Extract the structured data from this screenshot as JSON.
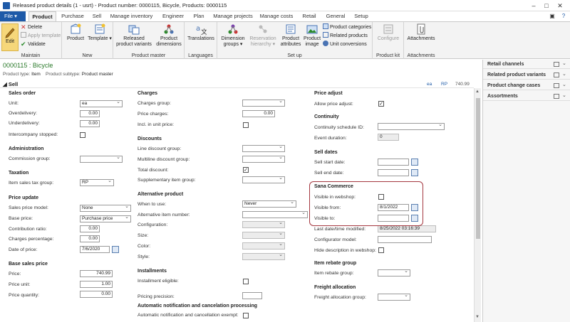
{
  "window": {
    "title": "Released product details (1 - usrt) - Product number: 0000115, Bicycle, Products: 0000115"
  },
  "ribbon_tabs": [
    "File",
    "Product",
    "Purchase",
    "Sell",
    "Manage inventory",
    "Engineer",
    "Plan",
    "Manage projects",
    "Manage costs",
    "Retail",
    "General",
    "Setup"
  ],
  "ribbon": {
    "maintain": {
      "label": "Maintain",
      "edit": "Edit",
      "delete": "Delete",
      "apply_template": "Apply template",
      "validate": "Validate"
    },
    "new": {
      "label": "New",
      "product": "Product",
      "template": "Template"
    },
    "product_master": {
      "label": "Product master",
      "variants": "Released product variants",
      "dimensions": "Product dimensions"
    },
    "languages": {
      "label": "Languages",
      "translations": "Translations"
    },
    "setup": {
      "label": "Set up",
      "dimension_groups": "Dimension groups",
      "reservation": "Reservation hierarchy",
      "attributes": "Product attributes",
      "image": "Product image",
      "categories": "Product categories",
      "related": "Related products",
      "unit_conv": "Unit conversions"
    },
    "product_kit": {
      "label": "Product kit",
      "configure": "Configure"
    },
    "attachments": {
      "label": "Attachments",
      "btn": "Attachments"
    }
  },
  "header": {
    "record": "0000115 : Bicycle",
    "type_label": "Product type:",
    "type_value": "Item",
    "subtype_label": "Product subtype:",
    "subtype_value": "Product master"
  },
  "fasttab": {
    "label": "Sell",
    "currency": "ea",
    "price_unit": "RP",
    "price": "740.99"
  },
  "col1": {
    "sales_order": "Sales order",
    "unit_label": "Unit:",
    "unit": "ea",
    "overdelivery_label": "Overdelivery:",
    "overdelivery": "0.00",
    "underdelivery_label": "Underdelivery:",
    "underdelivery": "0.00",
    "intercompany_label": "Intercompany stopped:",
    "administration": "Administration",
    "commission_label": "Commission group:",
    "taxation": "Taxation",
    "tax_label": "Item sales tax group:",
    "tax": "RP",
    "price_update": "Price update",
    "spm_label": "Sales price model:",
    "spm": "None",
    "base_label": "Base price:",
    "base": "Purchase price",
    "contrib_label": "Contribution ratio:",
    "contrib": "0.00",
    "charges_pct_label": "Charges percentage:",
    "charges_pct": "0.00",
    "date_label": "Date of price:",
    "date": "7/6/2020",
    "base_sales": "Base sales price",
    "price_label": "Price:",
    "price": "740.99",
    "unit2_label": "Price unit:",
    "unit2": "1.00",
    "qty_label": "Price quantity:",
    "qty": "0.00"
  },
  "col2": {
    "charges": "Charges",
    "cg_label": "Charges group:",
    "cp_label": "Price charges:",
    "cp": "0.00",
    "incl_label": "Incl. in unit price:",
    "discounts": "Discounts",
    "ldg_label": "Line discount group:",
    "mdg_label": "Multiline discount group:",
    "total_label": "Total discount:",
    "supp_label": "Supplementary item group:",
    "alt": "Alternative product",
    "when_label": "When to use:",
    "when": "Never",
    "altnum_label": "Alternative item number:",
    "config_label": "Configuration:",
    "size_label": "Size:",
    "color_label": "Color:",
    "style_label": "Style:",
    "install": "Installments",
    "inst_label": "Installment eligible:",
    "prec_label": "Pricing precision:",
    "auto": "Automatic notification and cancelation processing",
    "autoex_label": "Automatic notification and cancellation exempt:"
  },
  "col3": {
    "price_adjust": "Price adjust",
    "allow_label": "Allow price adjust:",
    "continuity": "Continuity",
    "cs_label": "Continuity schedule ID:",
    "ed_label": "Event duration:",
    "ed": "0",
    "sell_dates": "Sell dates",
    "ssd_label": "Sell start date:",
    "sed_label": "Sell end date:",
    "sana": "Sana Commerce",
    "vis_label": "Visible in webshop:",
    "vfrom_label": "Visible from:",
    "vfrom": "8/1/2022",
    "vto_label": "Visible to:",
    "last_label": "Last date/time modified:",
    "last": "8/25/2022 03:16:39",
    "cm_label": "Configurator model:",
    "hide_label": "Hide description in webshop:",
    "rebate": "Item rebate group",
    "irg_label": "Item rebate group:",
    "freight": "Freight allocation",
    "fag_label": "Freight allocation group:"
  },
  "factbox": [
    "Retail channels",
    "Related product variants",
    "Product change cases",
    "Assortments"
  ]
}
